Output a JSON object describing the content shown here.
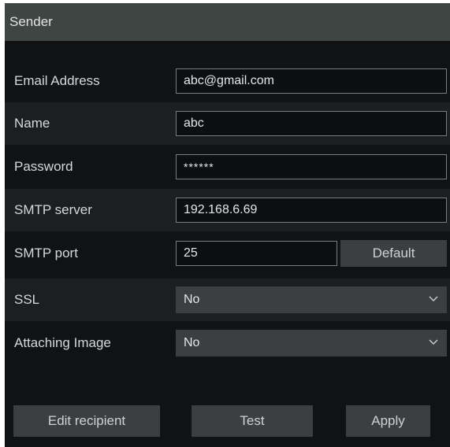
{
  "section": {
    "title": "Sender"
  },
  "form": {
    "email": {
      "label": "Email Address",
      "value": "abc@gmail.com"
    },
    "name": {
      "label": "Name",
      "value": "abc"
    },
    "password": {
      "label": "Password",
      "value": "******"
    },
    "smtp_server": {
      "label": "SMTP server",
      "value": "192.168.6.69"
    },
    "smtp_port": {
      "label": "SMTP port",
      "value": "25",
      "default_button": "Default"
    },
    "ssl": {
      "label": "SSL",
      "selected": "No",
      "icon": "chevron-down-icon"
    },
    "attaching_image": {
      "label": "Attaching Image",
      "selected": "No",
      "icon": "chevron-down-icon"
    }
  },
  "actions": {
    "edit_recipient": "Edit recipient",
    "test": "Test",
    "apply": "Apply"
  },
  "colors": {
    "background": "#111214",
    "header": "#3e4542",
    "alt_row": "#1d1e20",
    "control": "#3c3e42",
    "field_border": "#7a7d80"
  }
}
